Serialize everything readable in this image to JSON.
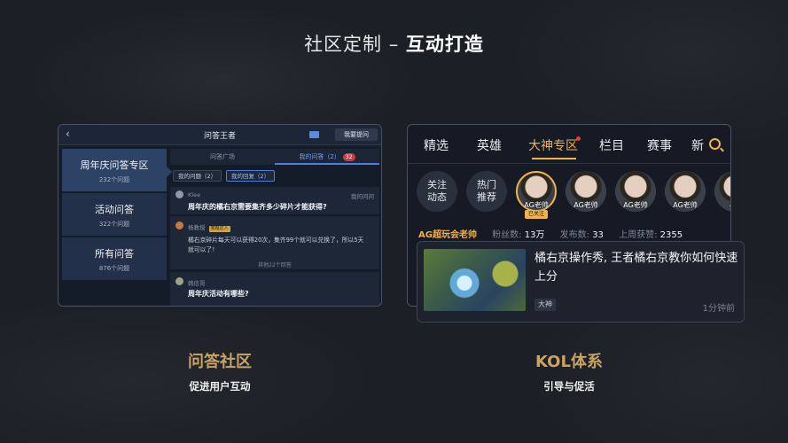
{
  "headline": {
    "prefix": "社区定制 – ",
    "bold": "互动打造"
  },
  "qa": {
    "back_icon": "chevron-left-icon",
    "title": "问答王者",
    "mail_icon": "mail-icon",
    "ask_button": "我要提问",
    "categories": [
      {
        "title": "周年庆问答专区",
        "count": "232个问题"
      },
      {
        "title": "活动问答",
        "count": "322个问题"
      },
      {
        "title": "所有问答",
        "count": "876个问题"
      }
    ],
    "tabs": {
      "square": "问答广场",
      "mine": "我的问答（2）",
      "mine_badge": "32"
    },
    "filters": {
      "my_questions": "我的问题（2）",
      "my_answers": "我的回复（2）"
    },
    "cards": [
      {
        "user": "Klee",
        "meta": "我的问问",
        "question": "周年庆的橘右京需要集齐多少碎片才能获得?"
      },
      {
        "user": "杨教授",
        "tag": "答题达人",
        "answer": "橘右京碎片每天可以获得20次，集齐99个就可以兑换了，所以5天就可以了！",
        "more": "其他22个回答"
      },
      {
        "user": "韩信哥",
        "question": "周年庆活动有哪些?"
      }
    ]
  },
  "kol": {
    "tabs": [
      "精选",
      "英雄",
      "大神专区",
      "栏目",
      "赛事",
      "新"
    ],
    "active_tab": "大神专区",
    "search_icon": "search-icon",
    "pills": [
      "关注\n动态",
      "热门\n推荐"
    ],
    "hosts": [
      {
        "name": "AG老帅",
        "follow": "已关注"
      },
      {
        "name": "AG老帅"
      },
      {
        "name": "AG老帅"
      },
      {
        "name": "AG老帅"
      },
      {
        "name": "AG"
      }
    ],
    "stats": {
      "name": "AG超玩会老帅",
      "fans_label": "粉丝数:",
      "fans": "13万",
      "posts_label": "发布数:",
      "posts": "33",
      "likes_label": "上周获赞:",
      "likes": "2355"
    },
    "video": {
      "title": "橘右京操作秀, 王者橘右京教你如何快速上分",
      "tag": "大神",
      "time": "1分钟前"
    }
  },
  "captions": {
    "left": {
      "big": "问答社区",
      "small": "促进用户互动"
    },
    "right": {
      "big": "KOL体系",
      "small": "引导与促活"
    }
  }
}
